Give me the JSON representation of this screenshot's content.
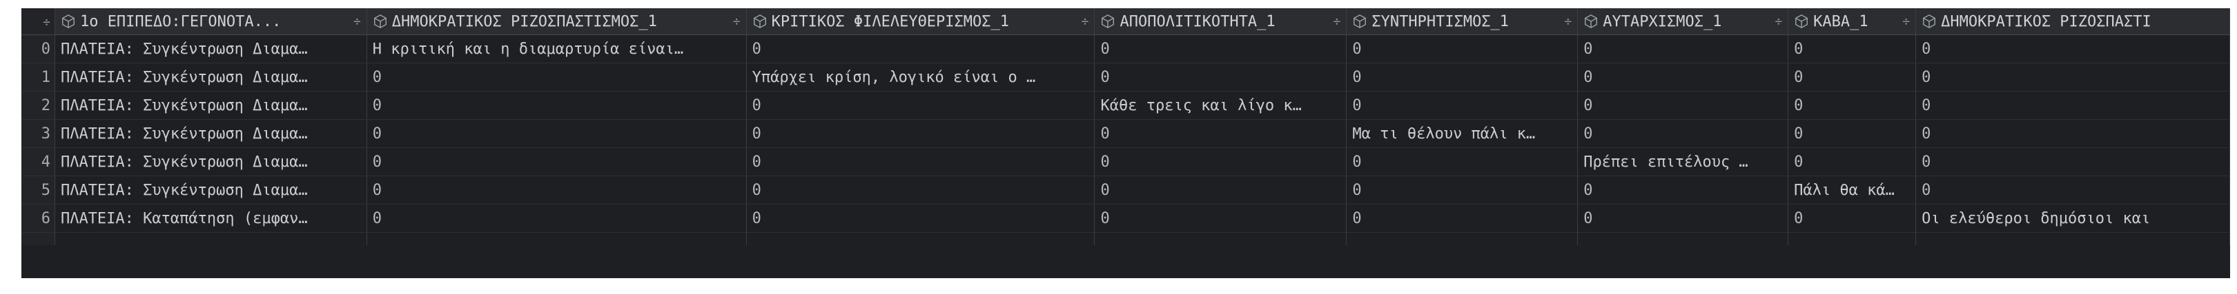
{
  "table": {
    "index_header": "÷",
    "columns": [
      {
        "label": "1ο ΕΠΙΠΕΔΟ:ΓΕΓΟΝΟΤΑ...",
        "sort": "÷"
      },
      {
        "label": "ΔΗΜΟΚΡΑΤΙΚΟΣ ΡΙΖΟΣΠΑΣΤΙΣΜΟΣ_1",
        "sort": "÷"
      },
      {
        "label": "ΚΡΙΤΙΚΟΣ ΦΙΛΕΛΕΥΘΕΡΙΣΜΟΣ_1",
        "sort": "÷"
      },
      {
        "label": "ΑΠΟΠΟΛΙΤΙΚΟΤΗΤΑ_1",
        "sort": "÷"
      },
      {
        "label": "ΣΥΝΤΗΡΗΤΙΣΜΟΣ_1",
        "sort": "÷"
      },
      {
        "label": "ΑΥΤΑΡΧΙΣΜΟΣ_1",
        "sort": "÷"
      },
      {
        "label": "ΚΑΒΑ_1",
        "sort": "÷"
      },
      {
        "label": "ΔΗΜΟΚΡΑΤΙΚΟΣ ΡΙΖΟΣΠΑΣΤΙ",
        "sort": ""
      }
    ],
    "rows": [
      {
        "index": "0",
        "cells": [
          "ΠΛΑΤΕΙΑ: Συγκέντρωση Διαμα…",
          "Η κριτική και η διαμαρτυρία είναι…",
          "0",
          "0",
          "0",
          "0",
          "0",
          "0"
        ]
      },
      {
        "index": "1",
        "cells": [
          "ΠΛΑΤΕΙΑ: Συγκέντρωση Διαμα…",
          "0",
          "Υπάρχει κρίση, λογικό είναι ο …",
          "0",
          "0",
          "0",
          "0",
          "0"
        ]
      },
      {
        "index": "2",
        "cells": [
          "ΠΛΑΤΕΙΑ: Συγκέντρωση Διαμα…",
          "0",
          "0",
          "Κάθε τρεις και λίγο κ…",
          "0",
          "0",
          "0",
          "0"
        ]
      },
      {
        "index": "3",
        "cells": [
          "ΠΛΑΤΕΙΑ: Συγκέντρωση Διαμα…",
          "0",
          "0",
          "0",
          "Μα τι θέλουν πάλι κ…",
          "0",
          "0",
          "0"
        ]
      },
      {
        "index": "4",
        "cells": [
          "ΠΛΑΤΕΙΑ: Συγκέντρωση Διαμα…",
          "0",
          "0",
          "0",
          "0",
          "Πρέπει επιτέλους …",
          "0",
          "0"
        ]
      },
      {
        "index": "5",
        "cells": [
          "ΠΛΑΤΕΙΑ: Συγκέντρωση Διαμα…",
          "0",
          "0",
          "0",
          "0",
          "0",
          "Πάλι θα κά…",
          "0"
        ]
      },
      {
        "index": "6",
        "cells": [
          "ΠΛΑΤΕΙΑ: Καταπάτηση (εμφαν…",
          "0",
          "0",
          "0",
          "0",
          "0",
          "0",
          "Οι ελεύθεροι δημόσιοι και"
        ]
      }
    ]
  },
  "colors": {
    "background": "#1e1f22",
    "header_background": "#2b2d30",
    "text": "#c9cdd3",
    "grid": "#3a3d42"
  },
  "icons": {
    "column_type": "cube-icon"
  }
}
